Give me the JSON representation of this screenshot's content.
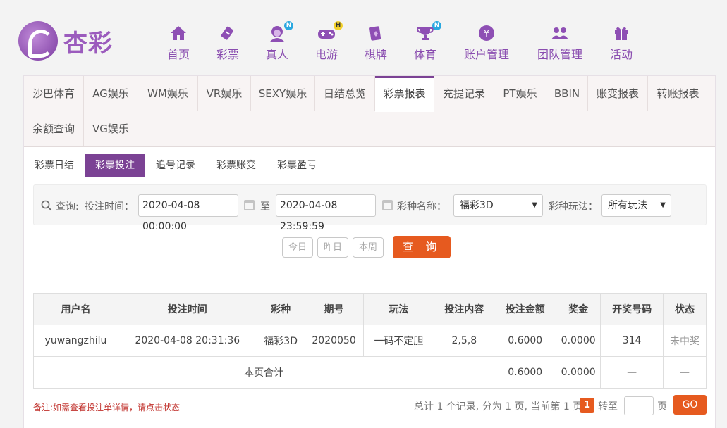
{
  "brand": {
    "name": "杏彩"
  },
  "nav": [
    {
      "label": "首页",
      "icon": "home-icon"
    },
    {
      "label": "彩票",
      "icon": "lottery-icon"
    },
    {
      "label": "真人",
      "icon": "live-dealer-icon",
      "badge": "N"
    },
    {
      "label": "电游",
      "icon": "gamepad-icon",
      "badge": "H"
    },
    {
      "label": "棋牌",
      "icon": "cards-icon"
    },
    {
      "label": "体育",
      "icon": "trophy-icon",
      "badge": "N"
    },
    {
      "label": "账户管理",
      "icon": "yen-coin-icon"
    },
    {
      "label": "团队管理",
      "icon": "team-icon"
    },
    {
      "label": "活动",
      "icon": "gift-icon"
    }
  ],
  "tabs": [
    "沙巴体育",
    "AG娱乐",
    "WM娱乐",
    "VR娱乐",
    "SEXY娱乐",
    "日结总览",
    "彩票报表",
    "充提记录",
    "PT娱乐",
    "BBIN",
    "账变报表",
    "转账报表",
    "余额查询",
    "VG娱乐"
  ],
  "active_tab": "彩票报表",
  "subtabs": [
    "彩票日结",
    "彩票投注",
    "追号记录",
    "彩票账变",
    "彩票盈亏"
  ],
  "active_subtab": "彩票投注",
  "query": {
    "label": "查询:",
    "time_label": "投注时间：",
    "start_time": "2020-04-08 00:00:00",
    "to_label": "至",
    "end_time": "2020-04-08 23:59:59",
    "lottery_label": "彩种名称：",
    "lottery_value": "福彩3D",
    "play_label": "彩种玩法：",
    "play_value": "所有玩法"
  },
  "quick_buttons": [
    "今日",
    "昨日",
    "本周"
  ],
  "search_button": "查 询",
  "table": {
    "headers": [
      "用户名",
      "投注时间",
      "彩种",
      "期号",
      "玩法",
      "投注内容",
      "投注金额",
      "奖金",
      "开奖号码",
      "状态"
    ],
    "rows": [
      [
        "yuwangzhilu",
        "2020-04-08 20:31:36",
        "福彩3D",
        "2020050",
        "一码不定胆",
        "2,5,8",
        "0.6000",
        "0.0000",
        "314",
        "未中奖"
      ]
    ],
    "subtotal": {
      "label": "本页合计",
      "amount": "0.6000",
      "bonus": "0.0000",
      "draw": "—",
      "status": "—"
    }
  },
  "note": "备注:如需查看投注单详情，请点击状态",
  "pager": {
    "summary": "总计 1 个记录, 分为 1 页, 当前第 1 页",
    "current": "1",
    "goto_label": "转至",
    "page_unit": "页",
    "go": "GO"
  },
  "colors": {
    "accent": "#7b4294",
    "orange": "#e65a1f",
    "note": "#c0302b"
  }
}
